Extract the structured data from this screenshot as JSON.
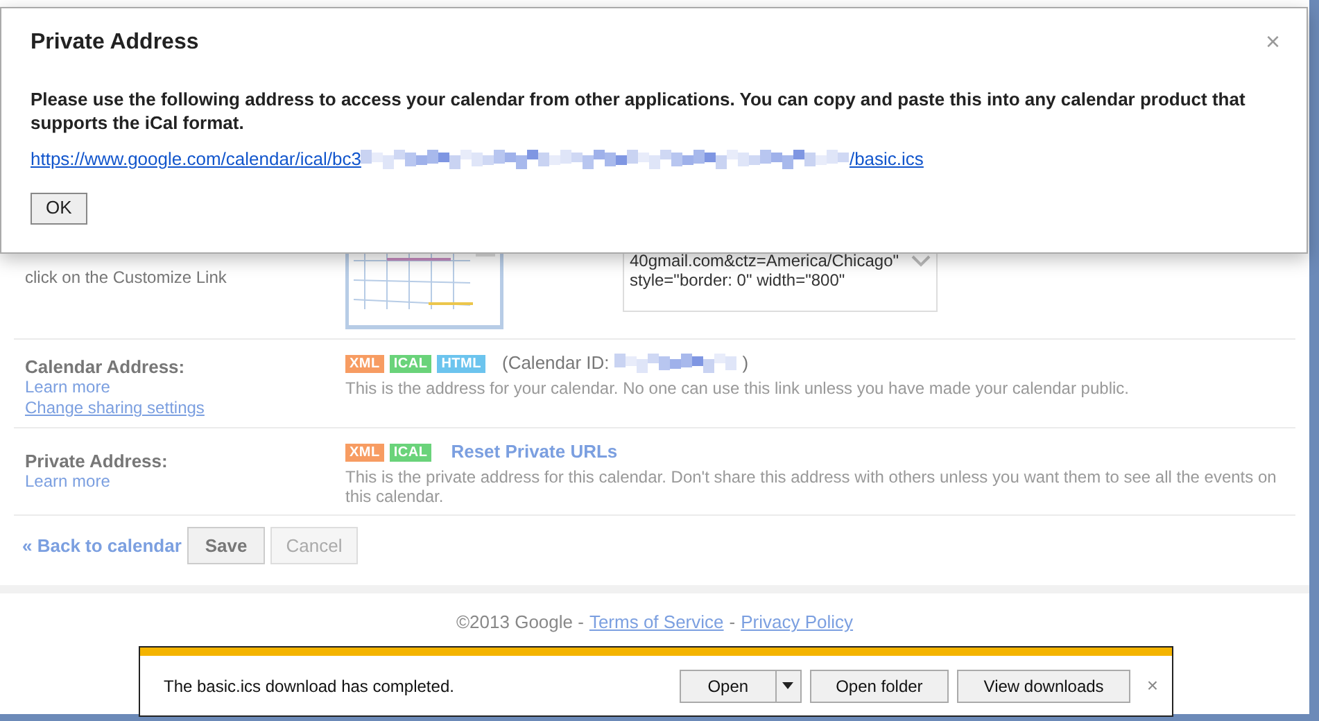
{
  "dialog": {
    "title": "Private Address",
    "close": "×",
    "message": "Please use the following address to access your calendar from other applications. You can copy and paste this into any calendar product that supports the iCal format.",
    "url_start": "https://www.google.com/calendar/ical/bc3",
    "url_end": "/basic.ics",
    "ok": "OK"
  },
  "embed": {
    "hint": "click on the Customize Link",
    "code_lines": [
      "40gmail.com&ctz=America/Chicago\"",
      "style=\"border: 0\" width=\"800\""
    ]
  },
  "rows": [
    {
      "label": "Calendar Address:",
      "links": [
        "Learn more",
        "Change sharing settings"
      ],
      "badges": [
        {
          "text": "XML",
          "color": "#f79c62"
        },
        {
          "text": "ICAL",
          "color": "#6ad37a"
        },
        {
          "text": "HTML",
          "color": "#6cc4ee"
        }
      ],
      "id_open": "(Calendar ID:",
      "id_close": ")",
      "description": "This is the address for your calendar. No one can use this link unless you have made your calendar public."
    },
    {
      "label": "Private Address:",
      "links": [
        "Learn more"
      ],
      "badges": [
        {
          "text": "XML",
          "color": "#f79c62"
        },
        {
          "text": "ICAL",
          "color": "#6ad37a"
        }
      ],
      "reset": "Reset Private URLs",
      "description": "This is the private address for this calendar. Don't share this address with others unless you want them to see all the events on this calendar."
    }
  ],
  "actions": {
    "back": "« Back to calendar",
    "save": "Save",
    "cancel": "Cancel"
  },
  "footer": {
    "copyright": "©2013 Google -",
    "terms": "Terms of Service",
    "separator": "-",
    "privacy": "Privacy Policy"
  },
  "download_bar": {
    "message": "The basic.ics download has completed.",
    "open": "Open",
    "open_folder": "Open folder",
    "view_downloads": "View downloads",
    "close": "×"
  }
}
